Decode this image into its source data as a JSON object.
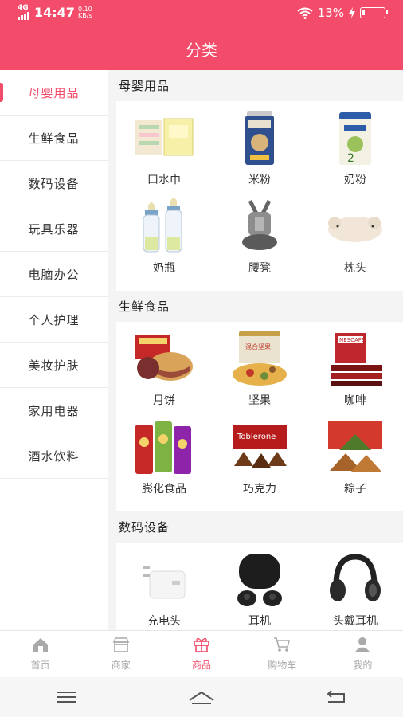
{
  "status_bar": {
    "network": "4G",
    "time": "14:47",
    "speed_value": "0.10",
    "speed_unit": "KB/s",
    "battery_percent": "13%",
    "battery_level": 0.13
  },
  "header": {
    "title": "分类"
  },
  "sidebar": {
    "active_index": 0,
    "items": [
      {
        "label": "母婴用品"
      },
      {
        "label": "生鲜食品"
      },
      {
        "label": "数码设备"
      },
      {
        "label": "玩具乐器"
      },
      {
        "label": "电脑办公"
      },
      {
        "label": "个人护理"
      },
      {
        "label": "美妆护肤"
      },
      {
        "label": "家用电器"
      },
      {
        "label": "酒水饮料"
      }
    ]
  },
  "sections": [
    {
      "title": "母婴用品",
      "items": [
        {
          "label": "口水巾",
          "icon": "bib-towel-image"
        },
        {
          "label": "米粉",
          "icon": "rice-cereal-can-image"
        },
        {
          "label": "奶粉",
          "icon": "milk-powder-can-image"
        },
        {
          "label": "奶瓶",
          "icon": "baby-bottle-image"
        },
        {
          "label": "腰凳",
          "icon": "baby-carrier-image"
        },
        {
          "label": "枕头",
          "icon": "pillow-image"
        }
      ]
    },
    {
      "title": "生鲜食品",
      "items": [
        {
          "label": "月饼",
          "icon": "mooncake-image"
        },
        {
          "label": "坚果",
          "icon": "nuts-jar-image"
        },
        {
          "label": "咖啡",
          "icon": "coffee-box-image"
        },
        {
          "label": "膨化食品",
          "icon": "chips-can-image"
        },
        {
          "label": "巧克力",
          "icon": "chocolate-box-image"
        },
        {
          "label": "粽子",
          "icon": "zongzi-image"
        }
      ]
    },
    {
      "title": "数码设备",
      "items": [
        {
          "label": "充电头",
          "icon": "charger-image"
        },
        {
          "label": "耳机",
          "icon": "earbuds-image"
        },
        {
          "label": "头戴耳机",
          "icon": "headphones-image"
        },
        {
          "label": "",
          "icon": "phone-image"
        },
        {
          "label": "",
          "icon": "phone-image-2"
        },
        {
          "label": "",
          "icon": "device-image"
        }
      ]
    }
  ],
  "tab_bar": {
    "active_index": 2,
    "tabs": [
      {
        "label": "首页",
        "icon": "home-icon"
      },
      {
        "label": "商家",
        "icon": "store-icon"
      },
      {
        "label": "商品",
        "icon": "gift-icon"
      },
      {
        "label": "购物车",
        "icon": "cart-icon"
      },
      {
        "label": "我的",
        "icon": "user-icon"
      }
    ]
  },
  "colors": {
    "accent": "#f24c6a",
    "tab_inactive": "#aaaaaa",
    "content_bg": "#f4f4f4"
  }
}
